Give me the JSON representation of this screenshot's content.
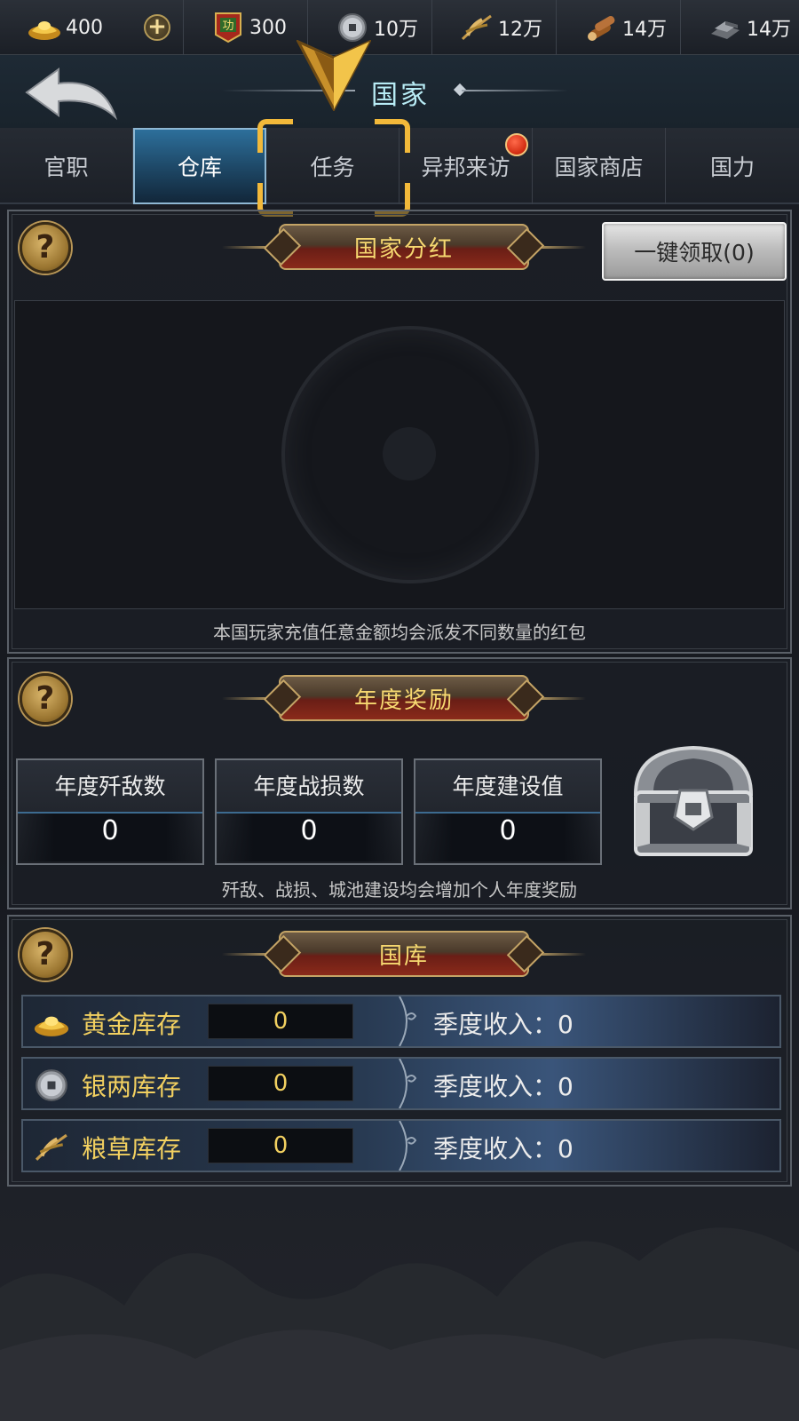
{
  "resources": [
    {
      "icon": "gold-ingot-icon",
      "value": "400"
    },
    {
      "icon": "merit-badge-icon",
      "value": "300",
      "badge_char": "功"
    },
    {
      "icon": "silver-coin-icon",
      "value": "10万"
    },
    {
      "icon": "grain-icon",
      "value": "12万"
    },
    {
      "icon": "wood-icon",
      "value": "14万"
    },
    {
      "icon": "iron-icon",
      "value": "14万"
    }
  ],
  "header": {
    "title": "国家"
  },
  "tabs": [
    {
      "label": "官职",
      "active": false
    },
    {
      "label": "仓库",
      "active": true
    },
    {
      "label": "任务",
      "active": false
    },
    {
      "label": "异邦来访",
      "active": false,
      "notification": true
    },
    {
      "label": "国家商店",
      "active": false
    },
    {
      "label": "国力",
      "active": false
    }
  ],
  "dividend": {
    "title": "国家分红",
    "claim_label": "一键领取(0)",
    "note": "本国玩家充值任意金额均会派发不同数量的红包"
  },
  "annual": {
    "title": "年度奖励",
    "stats": [
      {
        "label": "年度歼敌数",
        "value": "0"
      },
      {
        "label": "年度战损数",
        "value": "0"
      },
      {
        "label": "年度建设值",
        "value": "0"
      }
    ],
    "note": "歼敌、战损、城池建设均会增加个人年度奖励"
  },
  "treasury": {
    "title": "国库",
    "rows": [
      {
        "icon": "gold-ingot-icon",
        "label": "黄金库存",
        "value": "0",
        "income": "季度收入：0"
      },
      {
        "icon": "silver-coin-icon",
        "label": "银两库存",
        "value": "0",
        "income": "季度收入：0"
      },
      {
        "icon": "grain-icon",
        "label": "粮草库存",
        "value": "0",
        "income": "季度收入：0"
      }
    ]
  },
  "help_symbol": "?",
  "plus_symbol": "+",
  "colors": {
    "accent_gold": "#f6d870",
    "focus": "#f2b93a",
    "active_tab": "#2d6f9b"
  }
}
